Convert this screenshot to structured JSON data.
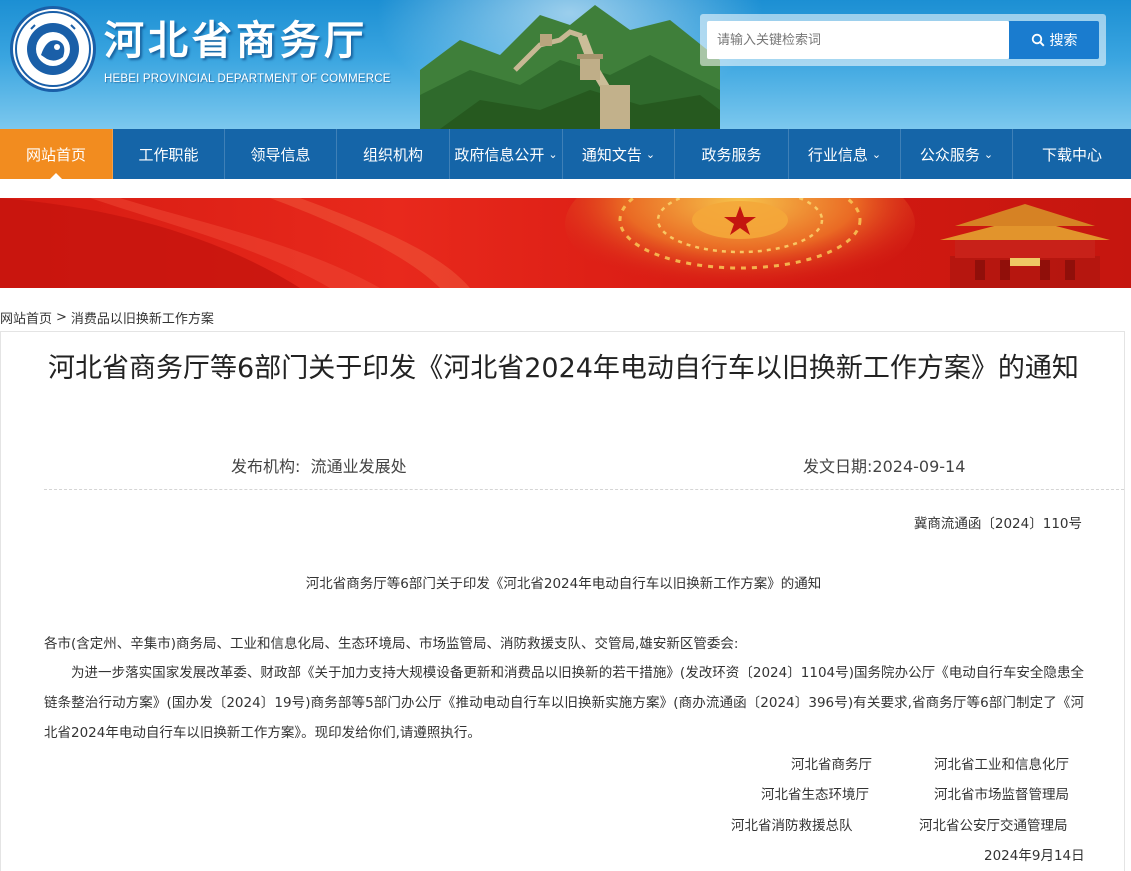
{
  "header": {
    "site_title": "河北省商务厅",
    "site_subtitle": "HEBEI PROVINCIAL DEPARTMENT OF COMMERCE",
    "search": {
      "placeholder": "请输入关键检索词",
      "button_label": "搜索"
    }
  },
  "nav": {
    "items": [
      {
        "label": "网站首页",
        "dropdown": false,
        "active": true
      },
      {
        "label": "工作职能",
        "dropdown": false
      },
      {
        "label": "领导信息",
        "dropdown": false
      },
      {
        "label": "组织机构",
        "dropdown": false
      },
      {
        "label": "政府信息公开",
        "dropdown": true
      },
      {
        "label": "通知文告",
        "dropdown": true
      },
      {
        "label": "政务服务",
        "dropdown": false
      },
      {
        "label": "行业信息",
        "dropdown": true
      },
      {
        "label": "公众服务",
        "dropdown": true
      },
      {
        "label": "下载中心",
        "dropdown": false
      }
    ]
  },
  "breadcrumb": {
    "home": "网站首页",
    "separator": ">",
    "current": "消费品以旧换新工作方案"
  },
  "article": {
    "title": "河北省商务厅等6部门关于印发《河北省2024年电动自行车以旧换新工作方案》的通知",
    "org_label": "发布机构:",
    "org_value": "流通业发展处",
    "date_label": "发文日期:",
    "date_value": "2024-09-14",
    "doc_number": "冀商流通函〔2024〕110号",
    "doc_subtitle": "河北省商务厅等6部门关于印发《河北省2024年电动自行车以旧换新工作方案》的通知",
    "addressee": "各市(含定州、辛集市)商务局、工业和信息化局、生态环境局、市场监管局、消防救援支队、交管局,雄安新区管委会:",
    "body": "为进一步落实国家发展改革委、财政部《关于加力支持大规模设备更新和消费品以旧换新的若干措施》(发改环资〔2024〕1104号)国务院办公厅《电动自行车安全隐患全链条整治行动方案》(国办发〔2024〕19号)商务部等5部门办公厅《推动电动自行车以旧换新实施方案》(商办流通函〔2024〕396号)有关要求,省商务厅等6部门制定了《河北省2024年电动自行车以旧换新工作方案》。现印发给你们,请遵照执行。",
    "signatories": [
      [
        "河北省商务厅",
        "河北省工业和信息化厅"
      ],
      [
        "河北省生态环境厅",
        "河北省市场监督管理局"
      ],
      [
        "河北省消防救援总队",
        "河北省公安厅交通管理局"
      ]
    ],
    "sign_date": "2024年9月14日"
  }
}
